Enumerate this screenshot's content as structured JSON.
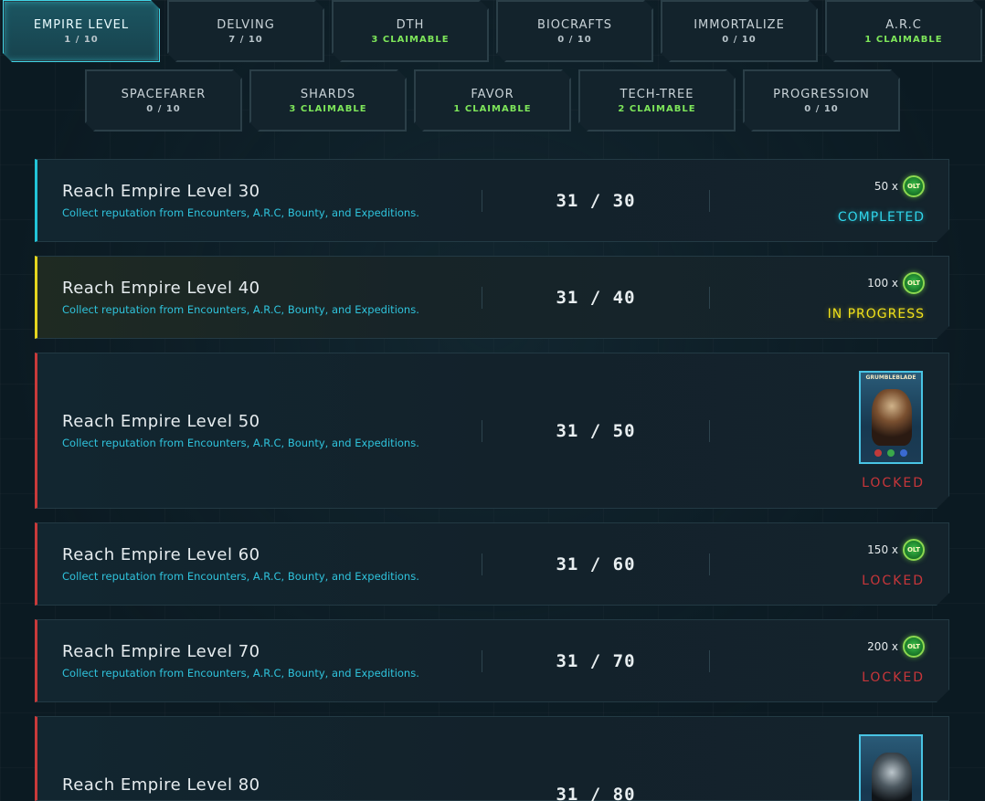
{
  "tabs_row1": [
    {
      "name": "EMPIRE LEVEL",
      "sub": "1 / 10",
      "claimable": false,
      "active": true
    },
    {
      "name": "DELVING",
      "sub": "7 / 10",
      "claimable": false
    },
    {
      "name": "DTH",
      "sub": "3 CLAIMABLE",
      "claimable": true
    },
    {
      "name": "BIOCRAFTS",
      "sub": "0 / 10",
      "claimable": false
    },
    {
      "name": "IMMORTALIZE",
      "sub": "0 / 10",
      "claimable": false
    },
    {
      "name": "A.R.C",
      "sub": "1 CLAIMABLE",
      "claimable": true
    }
  ],
  "tabs_row2": [
    {
      "name": "SPACEFARER",
      "sub": "0 / 10",
      "claimable": false
    },
    {
      "name": "SHARDS",
      "sub": "3 CLAIMABLE",
      "claimable": true
    },
    {
      "name": "FAVOR",
      "sub": "1 CLAIMABLE",
      "claimable": true
    },
    {
      "name": "TECH-TREE",
      "sub": "2 CLAIMABLE",
      "claimable": true
    },
    {
      "name": "PROGRESSION",
      "sub": "0 / 10",
      "claimable": false
    }
  ],
  "quests": [
    {
      "title": "Reach Empire Level 30",
      "desc": "Collect reputation from Encounters, A.R.C, Bounty, and Expeditions.",
      "progress": "31 / 30",
      "reward_amount": "50 x",
      "coin_label": "OLT",
      "status": "COMPLETED"
    },
    {
      "title": "Reach Empire Level 40",
      "desc": "Collect reputation from Encounters, A.R.C, Bounty, and Expeditions.",
      "progress": "31 / 40",
      "reward_amount": "100 x",
      "coin_label": "OLT",
      "status": "IN PROGRESS"
    },
    {
      "title": "Reach Empire Level 50",
      "desc": "Collect reputation from Encounters, A.R.C, Bounty, and Expeditions.",
      "progress": "31 / 50",
      "card_name": "GRUMBLEBLADE",
      "status": "LOCKED"
    },
    {
      "title": "Reach Empire Level 60",
      "desc": "Collect reputation from Encounters, A.R.C, Bounty, and Expeditions.",
      "progress": "31 / 60",
      "reward_amount": "150 x",
      "coin_label": "OLT",
      "status": "LOCKED"
    },
    {
      "title": "Reach Empire Level 70",
      "desc": "Collect reputation from Encounters, A.R.C, Bounty, and Expeditions.",
      "progress": "31 / 70",
      "reward_amount": "200 x",
      "coin_label": "OLT",
      "status": "LOCKED"
    },
    {
      "title": "Reach Empire Level 80",
      "progress": "31 / 80"
    }
  ],
  "colors": {
    "completed": "#2fd5ea",
    "in_progress": "#f1e11a",
    "locked": "#c8363a",
    "claimable": "#7ee65a"
  }
}
